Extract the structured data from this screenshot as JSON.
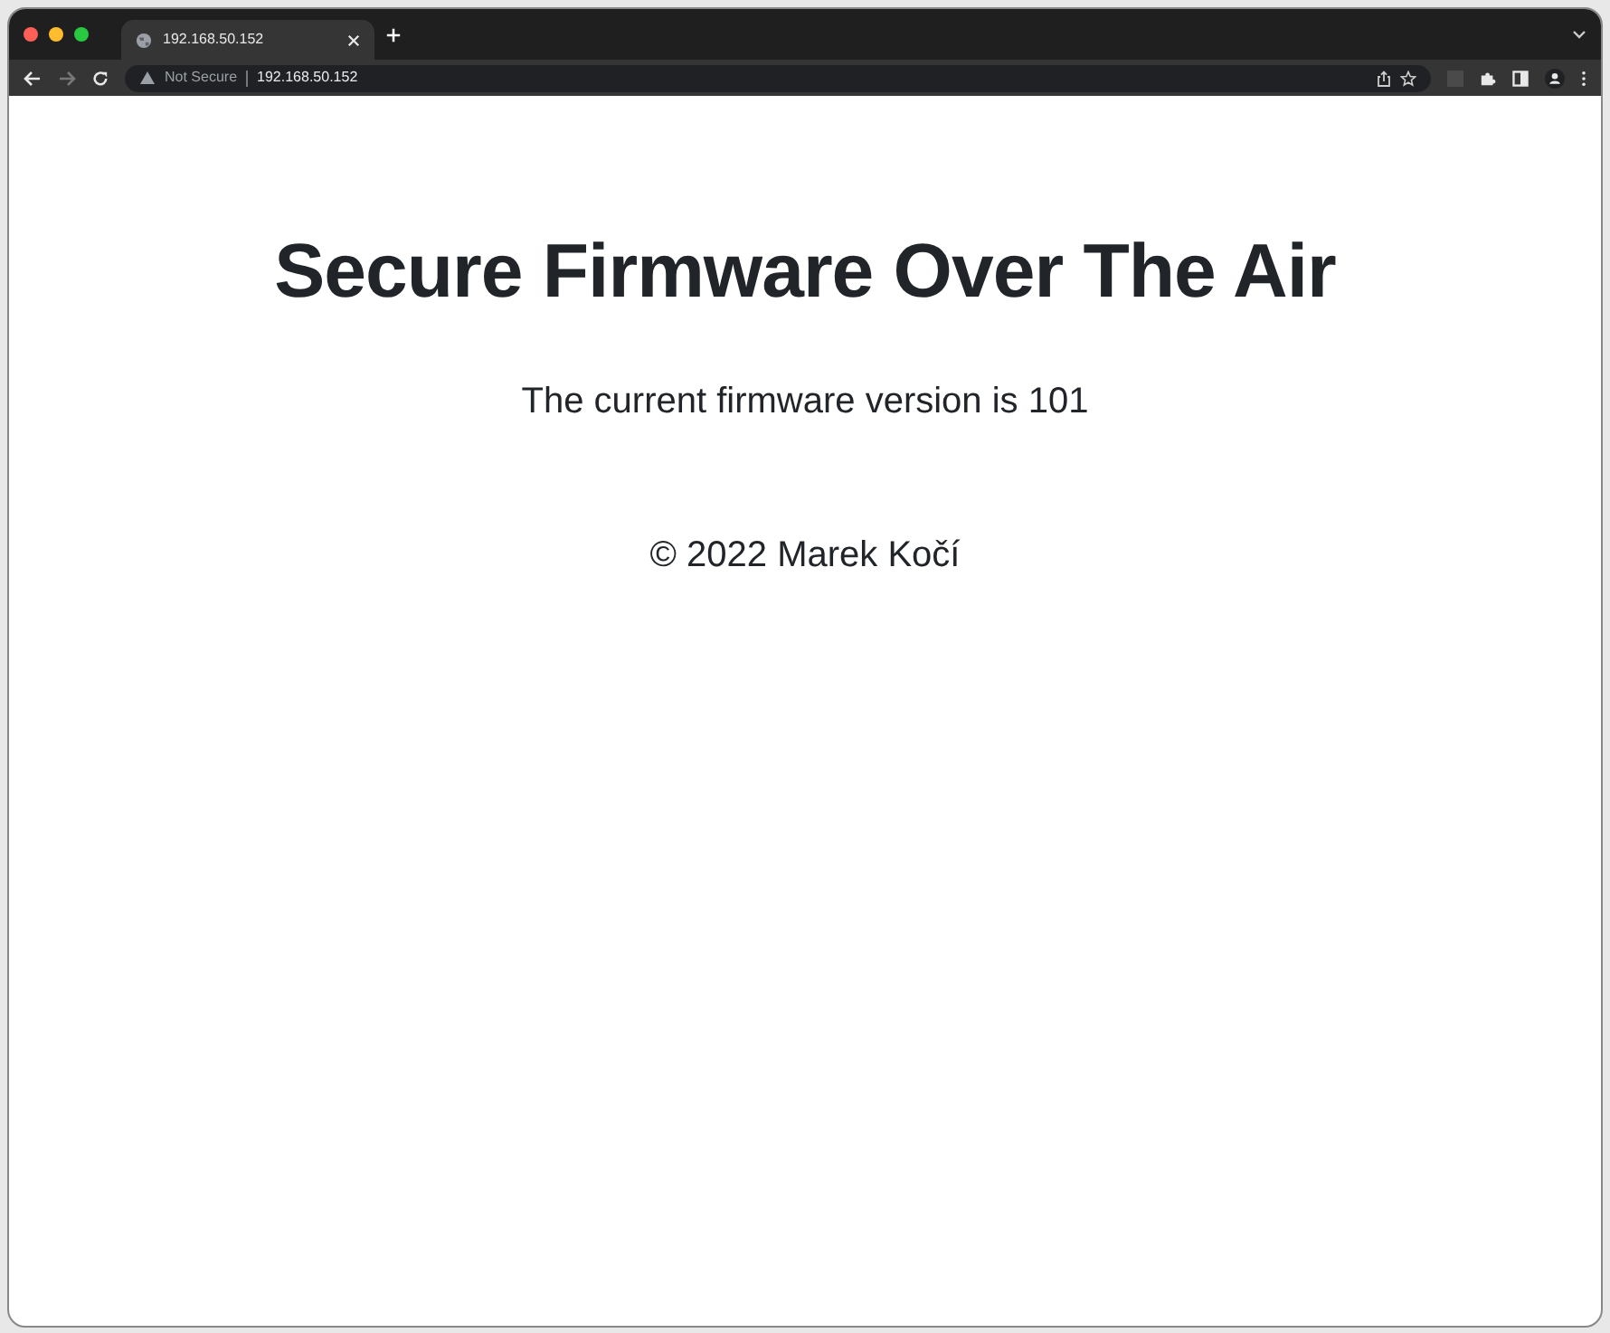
{
  "browser": {
    "tab": {
      "title": "192.168.50.152",
      "selected": true
    },
    "security_label": "Not Secure",
    "url": "192.168.50.152"
  },
  "page": {
    "heading": "Secure Firmware Over The Air",
    "version_text": "The current firmware version is 101",
    "footer": "© 2022 Marek Kočí"
  }
}
